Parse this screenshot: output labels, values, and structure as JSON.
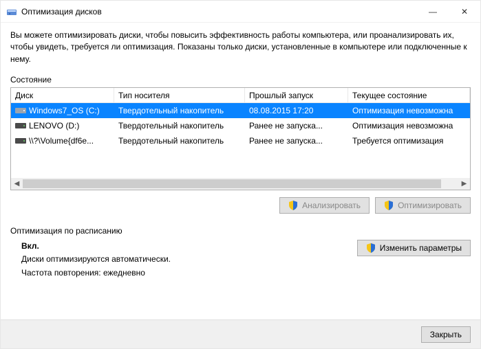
{
  "window": {
    "title": "Оптимизация дисков"
  },
  "intro": "Вы можете оптимизировать диски, чтобы повысить эффективность работы  компьютера, или проанализировать их, чтобы увидеть, требуется ли оптимизация. Показаны только диски, установленные в компьютере или подключенные к нему.",
  "state_label": "Состояние",
  "columns": {
    "disk": "Диск",
    "media": "Тип носителя",
    "last": "Прошлый запуск",
    "state": "Текущее состояние"
  },
  "rows": [
    {
      "disk": "Windows7_OS (C:)",
      "media": "Твердотельный накопитель",
      "last": "08.08.2015 17:20",
      "state": "Оптимизация невозможна",
      "selected": true,
      "icon": "light"
    },
    {
      "disk": "LENOVO (D:)",
      "media": "Твердотельный накопитель",
      "last": "Ранее не запуска...",
      "state": "Оптимизация невозможна",
      "selected": false,
      "icon": "dark"
    },
    {
      "disk": "\\\\?\\Volume{df6e...",
      "media": "Твердотельный накопитель",
      "last": "Ранее не запуска...",
      "state": "Требуется оптимизация",
      "selected": false,
      "icon": "dark"
    }
  ],
  "buttons": {
    "analyze": "Анализировать",
    "optimize": "Оптимизировать",
    "change_settings": "Изменить параметры",
    "close": "Закрыть"
  },
  "schedule": {
    "label": "Оптимизация по расписанию",
    "status": "Вкл.",
    "line1": "Диски оптимизируются автоматически.",
    "line2": "Частота повторения: ежедневно"
  }
}
